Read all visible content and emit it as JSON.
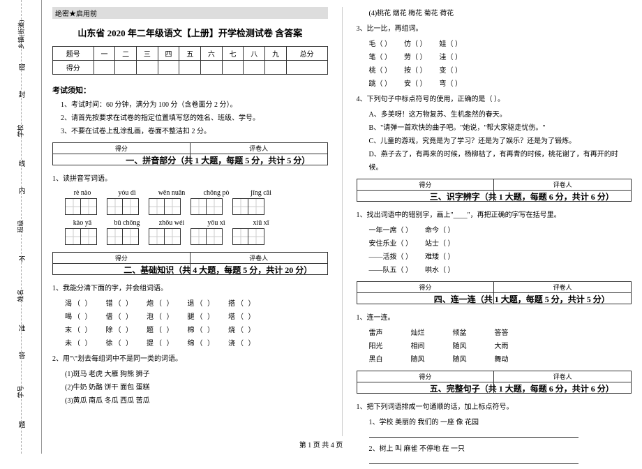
{
  "binding": {
    "fields": [
      "乡镇(街道)",
      "学校",
      "班级",
      "姓名",
      "学号"
    ],
    "fold_marks": [
      "密",
      "封",
      "线",
      "内",
      "不",
      "准",
      "答",
      "题"
    ]
  },
  "secret_mark": "绝密★启用前",
  "title": "山东省 2020 年二年级语文【上册】开学检测试卷 含答案",
  "score_header": [
    "题号",
    "一",
    "二",
    "三",
    "四",
    "五",
    "六",
    "七",
    "八",
    "九",
    "总分"
  ],
  "score_row_label": "得分",
  "notice_head": "考试须知：",
  "notices": [
    "1、考试时间：60 分钟，满分为 100 分（含卷面分 2 分）。",
    "2、请首先按要求在试卷的指定位置填写您的姓名、班级、学号。",
    "3、不要在试卷上乱涂乱画，卷面不整洁扣 2 分。"
  ],
  "score_box": {
    "c1": "得分",
    "c2": "评卷人"
  },
  "sections": {
    "s1": "一、拼音部分（共 1 大题，每题 5 分，共计 5 分）",
    "s2": "二、基础知识（共 4 大题，每题 5 分，共计 20 分）",
    "s3": "三、识字辨字（共 1 大题，每题 6 分，共计 6 分）",
    "s4": "四、连一连（共 1 大题，每题 5 分，共计 5 分）",
    "s5": "五、完整句子（共 1 大题，每题 6 分，共计 6 分）"
  },
  "q_s1_1": "1、读拼音写词语。",
  "pinyin_row1": [
    "rè  nào",
    "yóu  dì",
    "wēn  nuǎn",
    "chōng  pò",
    "jīng  cǎi"
  ],
  "pinyin_row2": [
    "kào  yā",
    "bǔ  chōng",
    "zhōu  wéi",
    "yōu  xì",
    "xiū  xī"
  ],
  "q_s2_1": "1、我能分清下面的字，并会组词语。",
  "s2_pairs": [
    [
      "渴（        ）",
      "错（        ）",
      "炮（        ）",
      "退（        ）",
      "搭（        ）"
    ],
    [
      "喝（        ）",
      "借（        ）",
      "泡（        ）",
      "腿（        ）",
      "塔（        ）"
    ],
    [
      "末（        ）",
      "除（        ）",
      "题（        ）",
      "棉（        ）",
      "烧（        ）"
    ],
    [
      "未（        ）",
      "徐（        ）",
      "提（        ）",
      "绵（        ）",
      "浇（        ）"
    ]
  ],
  "q_s2_2": "2、用\"\\\"划去每组词中不是同一类的词语。",
  "s2_groups": [
    "(1)斑马    老虎    大雁    狗熊    狮子",
    "(2)牛奶    奶酪    饼干    面包    蛋糕",
    "(3)黄瓜    南瓜    冬瓜    西瓜    苦瓜"
  ],
  "s2_line4": "(4)桃花    烟花    梅花    菊花    荷花",
  "q_s2_3": "3、比一比，再组词。",
  "s2_compare": [
    [
      "毛（        ）",
      "仿（        ）",
      "娃（        ）"
    ],
    [
      "笔（        ）",
      "劳（        ）",
      "洼（        ）"
    ],
    [
      "桃（        ）",
      "按（        ）",
      "变（        ）"
    ],
    [
      "跳（        ）",
      "安（        ）",
      "弯（        ）"
    ]
  ],
  "q_s2_4": "4、下列句子中标点符号的使用，正确的是（    ）。",
  "s2_opts": [
    "A、多美呀！这万物复苏、生机盎然的春天。",
    "B、\"请弹一首欢快的曲子吧。\"她说，\"帮大家驱走忧伤。\"",
    "C、儿童的游戏，究竟是为了学习？还是为了娱乐？还是为了锻炼。",
    "D、燕子去了，有再来的时候，杨柳枯了，有再青的时候，桃花谢了，有再开的时候。"
  ],
  "q_s3_1": "1、找出词语中的错别字，画上\"____\"，再把正确的字写在括号里。",
  "s3_items": [
    [
      "一年一席（        ）",
      "命今（        ）"
    ],
    [
      "安住乐业（        ）",
      "站士（        ）"
    ],
    [
      "——活拨（        ）",
      "难矮（        ）"
    ],
    [
      "——队五（        ）",
      "哄水（        ）"
    ]
  ],
  "q_s4_1": "1、连一连。",
  "s4_cols": {
    "c1": [
      "雷声",
      "阳光",
      "黑白"
    ],
    "c2": [
      "灿烂",
      "相间",
      "随风"
    ],
    "c3": [
      "倾盆",
      "随风",
      "随风"
    ],
    "c4": [
      "答答",
      "大雨",
      "舞动"
    ]
  },
  "q_s5_1": "1、把下列词语排成一句通顺的话，加上标点符号。",
  "s5_lines": [
    "1、学校    美丽的    我们的    一座    像    花园",
    "2、树上    叫    麻雀    不停地    在    一只"
  ],
  "footer": "第 1 页 共 4 页"
}
